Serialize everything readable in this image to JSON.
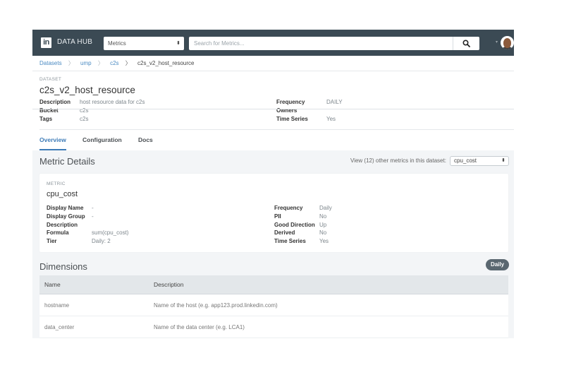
{
  "nav": {
    "brand_logo": "in",
    "brand": "DATA HUB",
    "type_select": "Metrics",
    "search_placeholder": "Search for Metrics...",
    "search_icon": "search-icon",
    "user_menu_caret": "▾"
  },
  "breadcrumb": {
    "items": [
      "Datasets",
      "ump",
      "c2s"
    ],
    "current": "c2s_v2_host_resource",
    "separator": "〉"
  },
  "dataset": {
    "label": "DATASET",
    "title": "c2s_v2_host_resource",
    "left": [
      {
        "k": "Description",
        "v": "host resource data for c2s"
      },
      {
        "k": "Bucket",
        "v": "c2s"
      },
      {
        "k": "Tags",
        "v": "c2s"
      }
    ],
    "right": [
      {
        "k": "Frequency",
        "v": "DAILY"
      },
      {
        "k": "Owners",
        "v": ""
      },
      {
        "k": "Time Series",
        "v": "Yes"
      }
    ]
  },
  "tabs": [
    {
      "label": "Overview",
      "active": true
    },
    {
      "label": "Configuration",
      "active": false
    },
    {
      "label": "Docs",
      "active": false
    }
  ],
  "metric_details": {
    "title": "Metric Details",
    "view_other_label": "View (12) other metrics in this dataset:",
    "selected_metric": "cpu_cost",
    "card": {
      "label": "METRIC",
      "title": "cpu_cost",
      "left": [
        {
          "k": "Display Name",
          "v": "-"
        },
        {
          "k": "Display Group",
          "v": "-"
        },
        {
          "k": "Description",
          "v": ""
        },
        {
          "k": "Formula",
          "v": "sum(cpu_cost)"
        },
        {
          "k": "Tier",
          "v": "Daily: 2"
        }
      ],
      "right": [
        {
          "k": "Frequency",
          "v": "Daily"
        },
        {
          "k": "PII",
          "v": "No"
        },
        {
          "k": "Good Direction",
          "v": "Up"
        },
        {
          "k": "Derived",
          "v": "No"
        },
        {
          "k": "Time Series",
          "v": "Yes"
        }
      ]
    }
  },
  "dimensions": {
    "title": "Dimensions",
    "badge": "Daily",
    "columns": [
      "Name",
      "Description"
    ],
    "rows": [
      {
        "name": "hostname",
        "description": "Name of the host (e.g. app123.prod.linkedin.com)"
      },
      {
        "name": "data_center",
        "description": "Name of the data center (e.g. LCA1)"
      }
    ]
  }
}
